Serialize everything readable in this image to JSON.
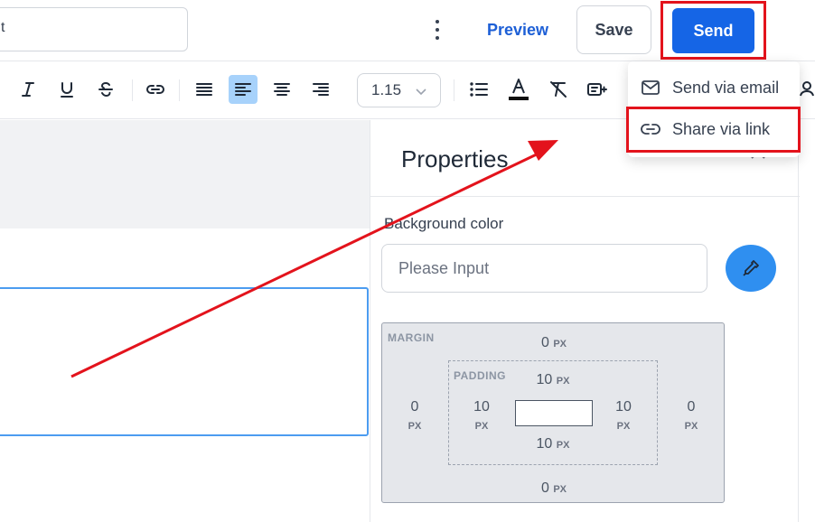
{
  "header": {
    "title_value": "t",
    "more_icon": "kebab-vertical-icon",
    "preview_label": "Preview",
    "save_label": "Save",
    "send_label": "Send"
  },
  "send_menu": {
    "items": [
      {
        "label": "Send via email",
        "icon": "mail-icon"
      },
      {
        "label": "Share via link",
        "icon": "link-icon"
      }
    ]
  },
  "toolbar": {
    "line_height": "1.15",
    "tools": [
      "italic-icon",
      "underline-icon",
      "strikethrough-icon",
      "link-icon",
      "align-justify-icon",
      "align-left-icon",
      "align-center-icon",
      "align-right-icon",
      "bulleted-list-icon",
      "text-color-icon",
      "clear-format-icon",
      "insert-variable-icon"
    ],
    "active_tool": "align-left-icon"
  },
  "properties": {
    "title": "Properties",
    "background_label": "Background color",
    "background_placeholder": "Please Input",
    "margin_label": "MARGIN",
    "padding_label": "PADDING",
    "unit": "PX",
    "margin": {
      "top": "0",
      "right": "0",
      "bottom": "0",
      "left": "0"
    },
    "padding": {
      "top": "10",
      "right": "10",
      "bottom": "10",
      "left": "10"
    }
  },
  "colors": {
    "primary": "#1565e6",
    "annotation": "#e3131c",
    "active_tool_bg": "#a7d2fb",
    "picker": "#2f8ff0"
  }
}
